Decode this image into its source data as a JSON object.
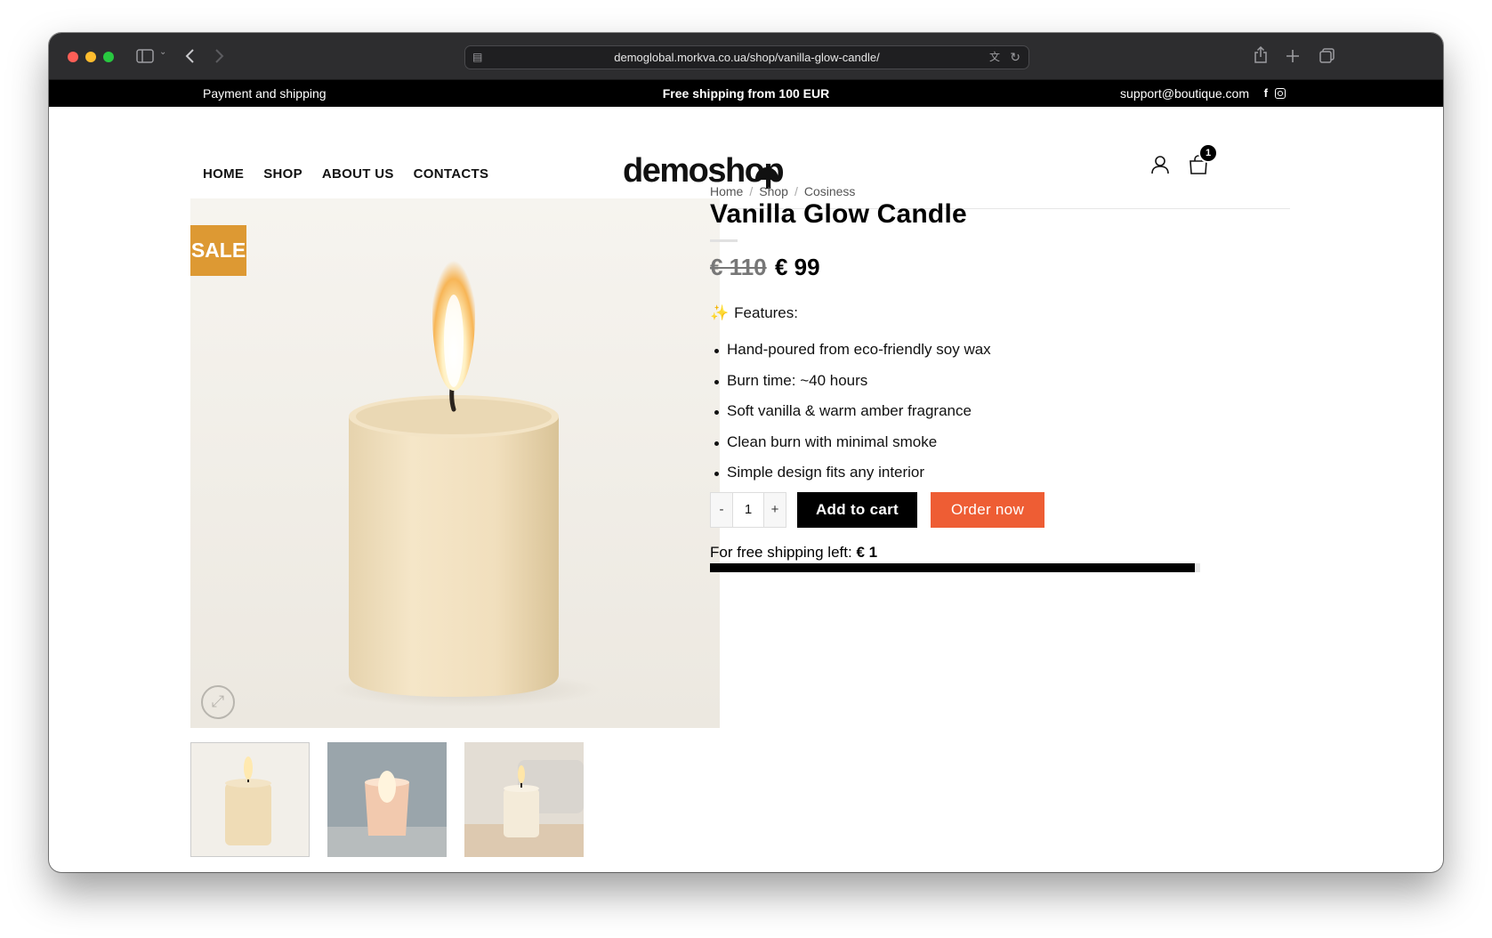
{
  "browser": {
    "url": "demoglobal.morkva.co.ua/shop/vanilla-glow-candle/"
  },
  "topbar": {
    "left_link": "Payment and shipping",
    "center_text": "Free shipping from 100 EUR",
    "email": "support@boutique.com",
    "facebook_glyph": "f"
  },
  "header": {
    "nav": [
      "HOME",
      "SHOP",
      "ABOUT US",
      "CONTACTS"
    ],
    "logo_text": "demoshop",
    "cart_count": "1"
  },
  "product": {
    "sale_badge": "SALE",
    "breadcrumb": [
      "Home",
      "Shop",
      "Cosiness"
    ],
    "title": "Vanilla Glow Candle",
    "price_old": "€ 110",
    "price_new": "€ 99",
    "features_icon": "✨",
    "features_heading": "Features:",
    "features": [
      "Hand-poured from eco-friendly soy wax",
      "Burn time: ~40 hours",
      "Soft vanilla & warm amber fragrance",
      "Clean burn with minimal smoke",
      "Simple design fits any interior"
    ],
    "quantity": "1",
    "qty_minus": "-",
    "qty_plus": "+",
    "add_to_cart_label": "Add to cart",
    "order_now_label": "Order now",
    "free_shipping_label": "For free shipping left:",
    "free_shipping_amount": "€ 1",
    "free_shipping_progress": 0.99,
    "thumbnails": [
      "candle-white-bg-thumb",
      "candle-glass-thumb",
      "candle-sofa-thumb"
    ]
  },
  "colors": {
    "sale_badge": "#dd9933",
    "order_now": "#ee5d34",
    "topbar_bg": "#000000",
    "primary_button": "#000000"
  }
}
